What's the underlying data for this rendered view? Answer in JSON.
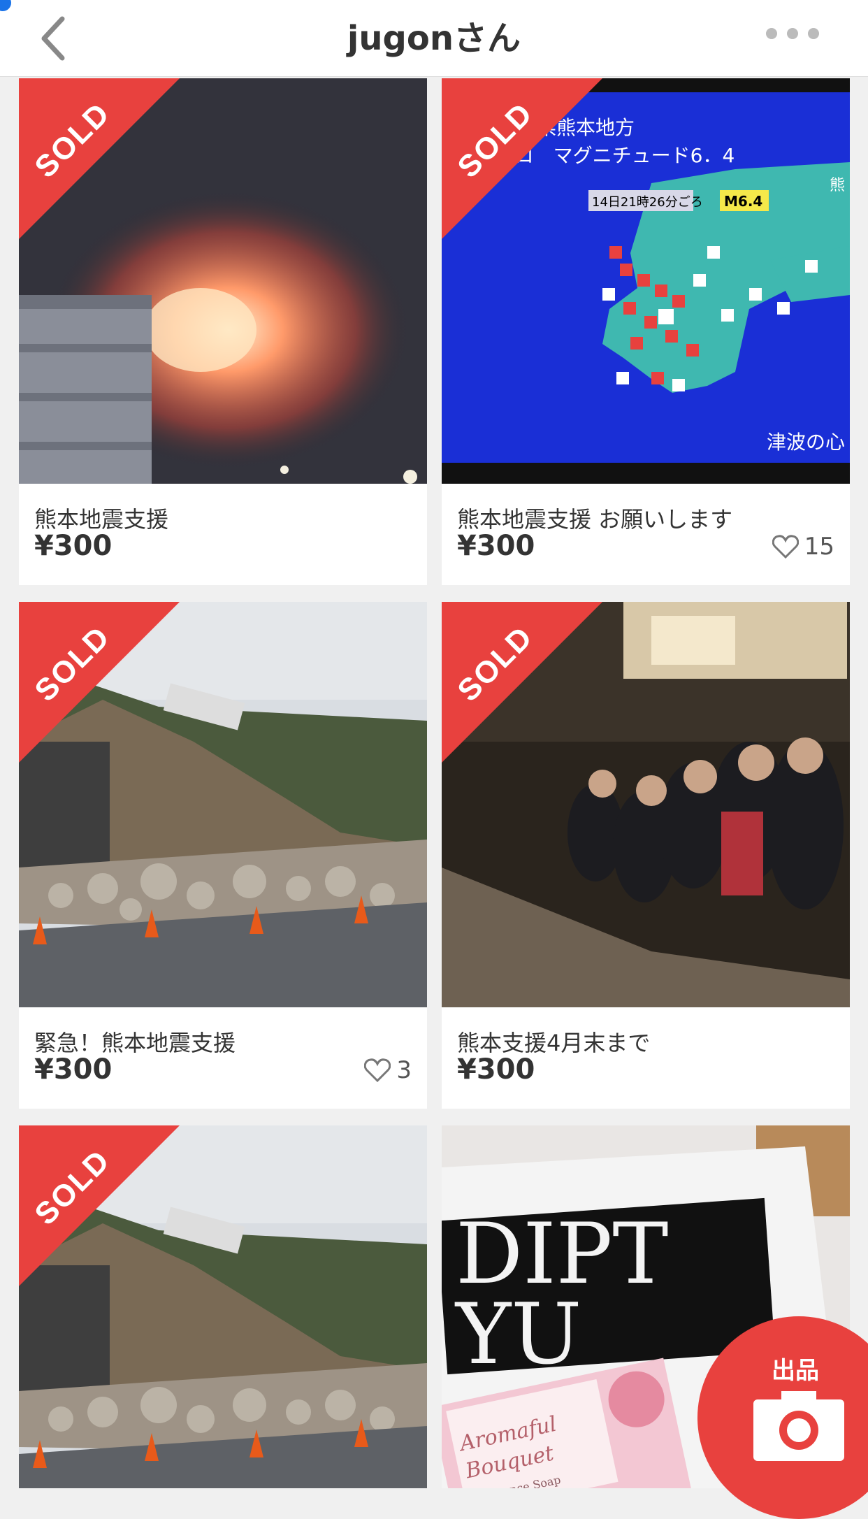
{
  "header": {
    "title": "jugonさん"
  },
  "sold_label": "SOLD",
  "items": [
    {
      "name": "熊本地震支援",
      "price": "¥300",
      "sold": true,
      "likes": null
    },
    {
      "name": "熊本地震支援 お願いします",
      "price": "¥300",
      "sold": true,
      "likes": "15"
    },
    {
      "name": "緊急！熊本地震支援",
      "price": "¥300",
      "sold": true,
      "likes": "3"
    },
    {
      "name": "熊本支援4月末まで",
      "price": "¥300",
      "sold": true,
      "likes": null
    },
    {
      "name": "",
      "price": "",
      "sold": true,
      "likes": null
    },
    {
      "name": "",
      "price": "",
      "sold": false,
      "likes": null
    }
  ],
  "photos": {
    "tv_screen": {
      "line1": "熊本県熊本地方",
      "line2": "10キロ　マグニチュード6．4",
      "time": "14日21時26分ごろ",
      "mag": "M6.4",
      "corner": "熊",
      "tsunami": "津波の心"
    },
    "product": {
      "bag_text1": "DIPT",
      "bag_text2": "YU",
      "soap_title1": "Aromaful",
      "soap_title2": "Bouquet",
      "soap_sub": "Fragrance Soap"
    }
  },
  "fab": {
    "label": "出品"
  },
  "colors": {
    "accent": "#e8413e",
    "background": "#f0f0f0"
  }
}
